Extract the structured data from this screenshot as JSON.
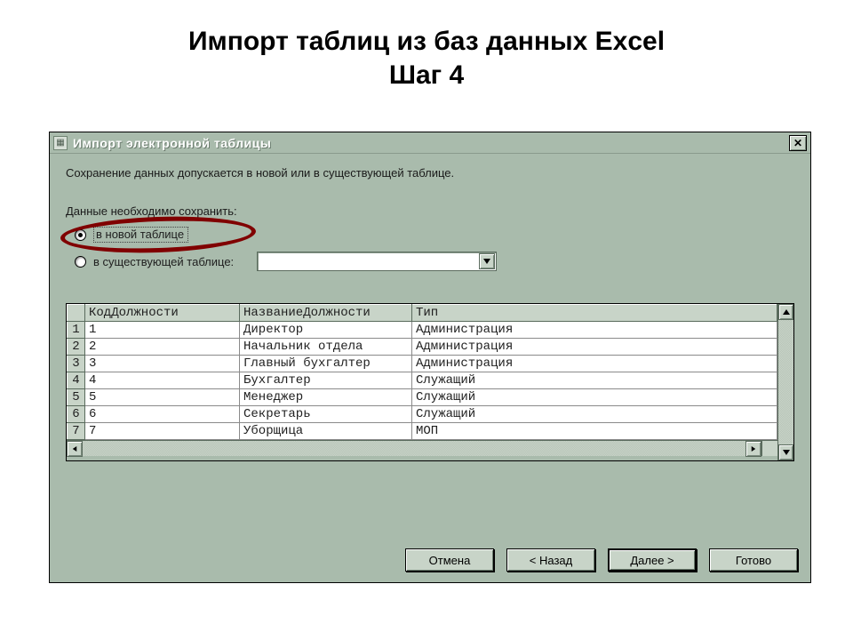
{
  "slide": {
    "title_line1": "Импорт таблиц из баз данных Excel",
    "title_line2": "Шаг 4"
  },
  "dialog": {
    "title": "Импорт электронной таблицы",
    "close_glyph": "✕",
    "intro": "Сохранение данных допускается в новой или в существующей таблице.",
    "prompt": "Данные необходимо сохранить:",
    "radios": {
      "new_table": "в новой таблице",
      "existing_table": "в существующей таблице:",
      "selected": "new_table"
    },
    "combo_value": "",
    "table": {
      "headers": [
        "КодДолжности",
        "НазваниеДолжности",
        "Тип"
      ],
      "rows": [
        {
          "n": "1",
          "cells": [
            "1",
            "Директор",
            "Администрация"
          ]
        },
        {
          "n": "2",
          "cells": [
            "2",
            "Начальник отдела",
            "Администрация"
          ]
        },
        {
          "n": "3",
          "cells": [
            "3",
            "Главный бухгалтер",
            "Администрация"
          ]
        },
        {
          "n": "4",
          "cells": [
            "4",
            "Бухгалтер",
            "Служащий"
          ]
        },
        {
          "n": "5",
          "cells": [
            "5",
            "Менеджер",
            "Служащий"
          ]
        },
        {
          "n": "6",
          "cells": [
            "6",
            "Секретарь",
            "Служащий"
          ]
        },
        {
          "n": "7",
          "cells": [
            "7",
            "Уборщица",
            "МОП"
          ]
        }
      ]
    },
    "buttons": {
      "cancel": "Отмена",
      "back": "< Назад",
      "next": "Далее >",
      "finish": "Готово"
    }
  }
}
